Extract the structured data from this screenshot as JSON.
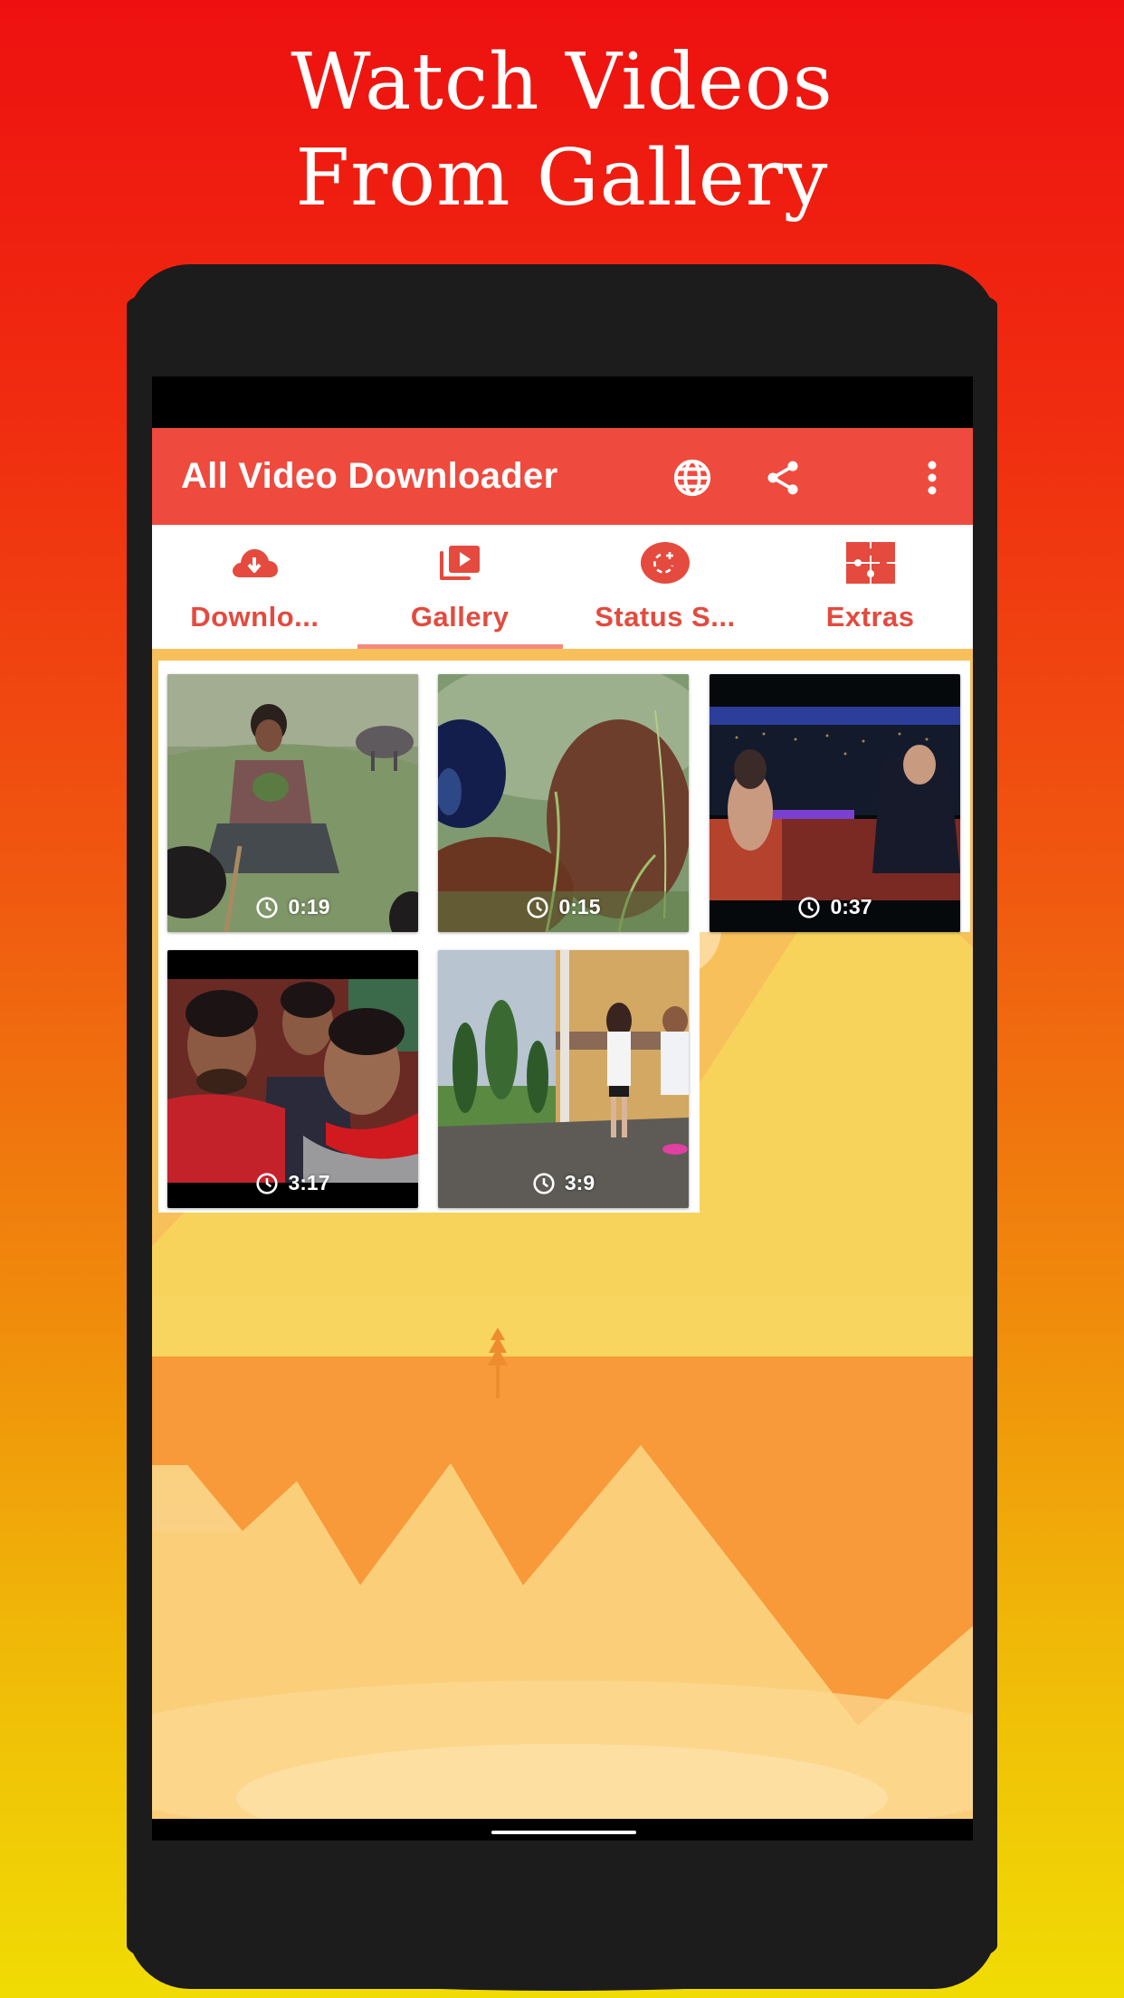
{
  "headline": {
    "line1": "Watch Videos",
    "line2": "From Gallery"
  },
  "colors": {
    "toolbar": "#ef4a3e",
    "accent": "#e44a3e",
    "tab_indicator": "#f48a7e",
    "phone_body": "#1c1c1c"
  },
  "app": {
    "title": "All Video Downloader",
    "actions": [
      {
        "name": "browser",
        "icon": "globe-icon"
      },
      {
        "name": "share",
        "icon": "share-icon"
      },
      {
        "name": "more",
        "icon": "more-vert-icon"
      }
    ]
  },
  "tabs": [
    {
      "label": "Downlo...",
      "icon": "cloud-download-icon",
      "active": false
    },
    {
      "label": "Gallery",
      "icon": "video-library-icon",
      "active": true
    },
    {
      "label": "Status S...",
      "icon": "status-add-icon",
      "active": false
    },
    {
      "label": "Extras",
      "icon": "puzzle-icon",
      "active": false
    }
  ],
  "gallery": {
    "videos": [
      {
        "duration": "0:19",
        "scene": "boy sitting on grass with buffalo"
      },
      {
        "duration": "0:15",
        "scene": "close-up of squirrel in grass"
      },
      {
        "duration": "0:37",
        "scene": "talk show set at night"
      },
      {
        "duration": "3:17",
        "scene": "men in red scarves"
      },
      {
        "duration": "3:9",
        "scene": "two women outside brick building"
      }
    ]
  }
}
